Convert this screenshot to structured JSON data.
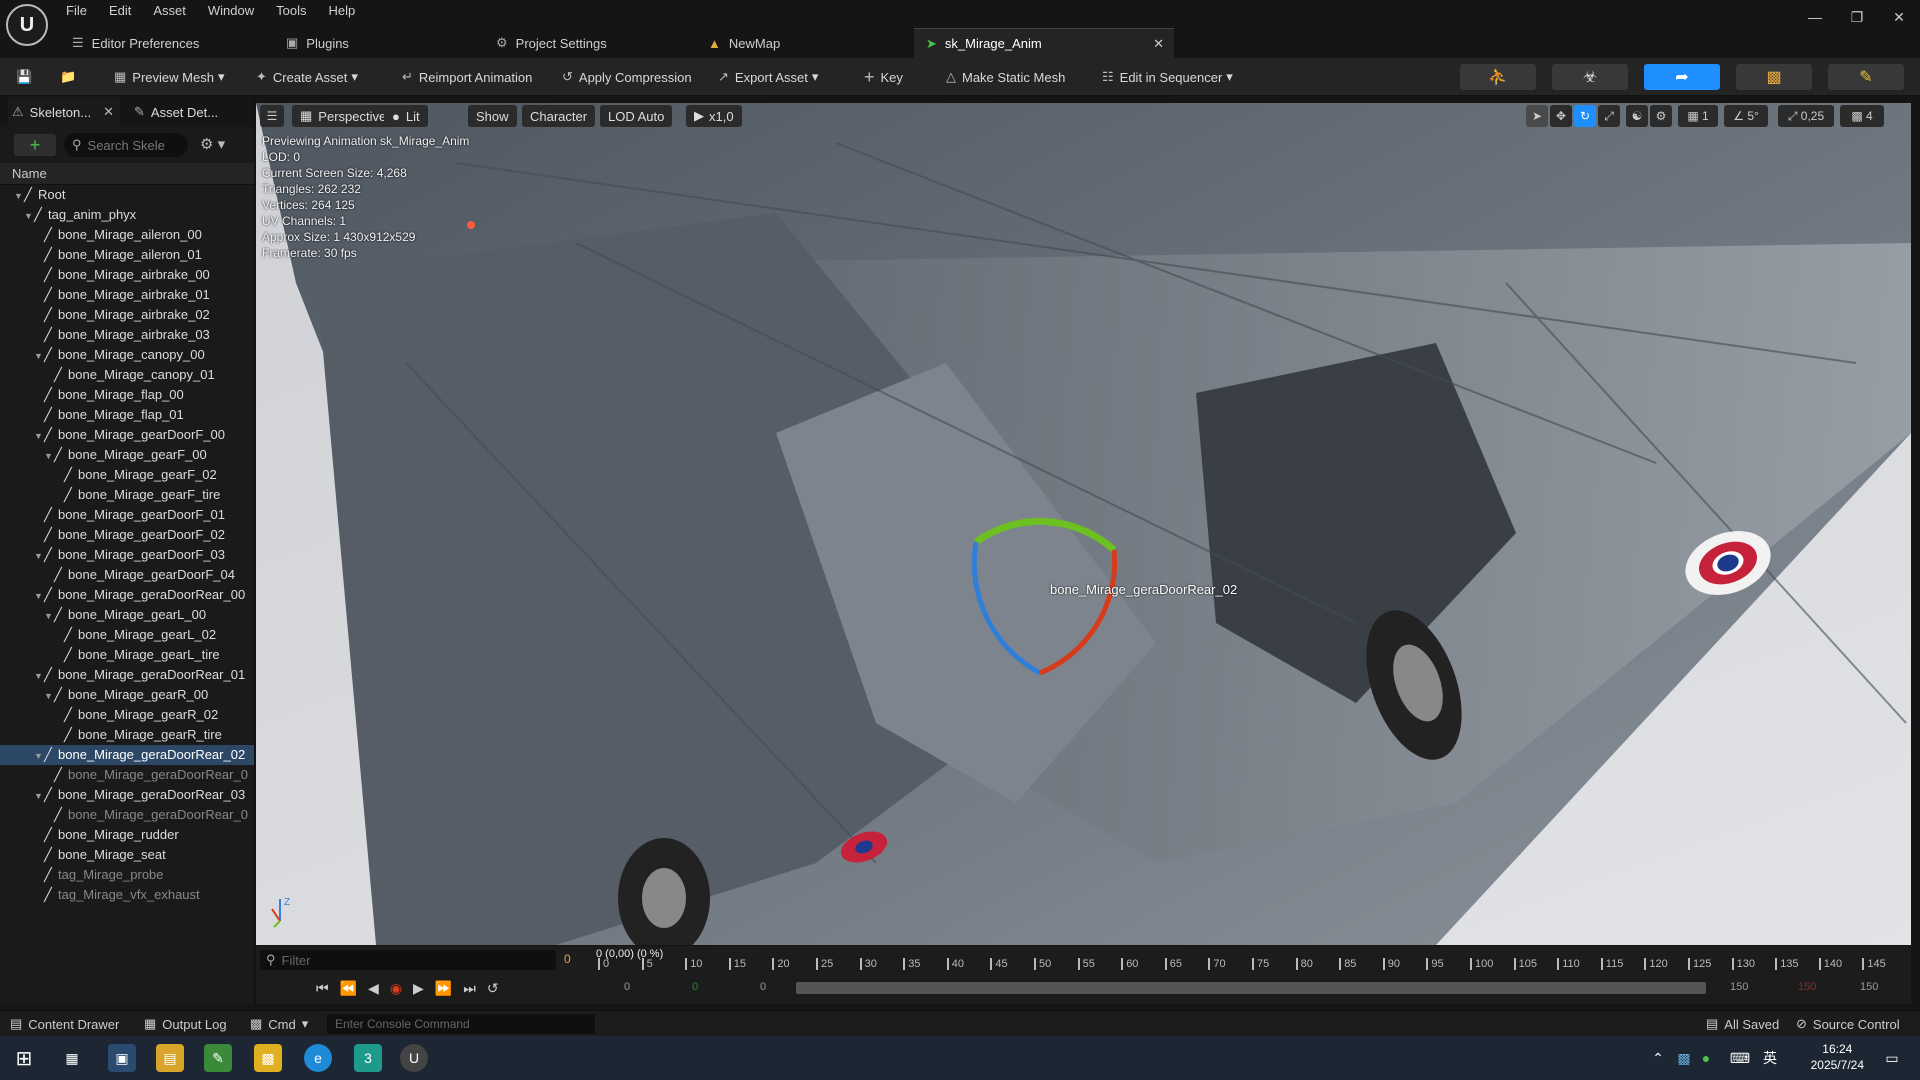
{
  "menubar": {
    "items": [
      "File",
      "Edit",
      "Asset",
      "Window",
      "Tools",
      "Help"
    ]
  },
  "editor_tabs": [
    {
      "label": "Editor Preferences",
      "icon": "sliders-icon"
    },
    {
      "label": "Plugins",
      "icon": "plug-icon"
    },
    {
      "label": "Project Settings",
      "icon": "gear-icon"
    },
    {
      "label": "NewMap",
      "icon": "map-icon"
    },
    {
      "label": "sk_Mirage_Anim",
      "icon": "animation-icon",
      "active": true
    }
  ],
  "toolbar": {
    "preview_mesh": "Preview Mesh",
    "create_asset": "Create Asset",
    "reimport": "Reimport Animation",
    "apply_compression": "Apply Compression",
    "export_asset": "Export Asset",
    "key": "Key",
    "make_static_mesh": "Make Static Mesh",
    "edit_in_sequencer": "Edit in Sequencer",
    "accent_color": "#1f8fff"
  },
  "left_panel": {
    "tabs": [
      "Skeleton...",
      "Asset Det..."
    ],
    "search_placeholder": "Search Skele",
    "column_header": "Name",
    "tree": [
      {
        "label": "Root",
        "depth": 0,
        "expanded": true
      },
      {
        "label": "tag_anim_phyx",
        "depth": 1,
        "expanded": true
      },
      {
        "label": "bone_Mirage_aileron_00",
        "depth": 2
      },
      {
        "label": "bone_Mirage_aileron_01",
        "depth": 2
      },
      {
        "label": "bone_Mirage_airbrake_00",
        "depth": 2
      },
      {
        "label": "bone_Mirage_airbrake_01",
        "depth": 2
      },
      {
        "label": "bone_Mirage_airbrake_02",
        "depth": 2
      },
      {
        "label": "bone_Mirage_airbrake_03",
        "depth": 2
      },
      {
        "label": "bone_Mirage_canopy_00",
        "depth": 2,
        "expanded": true
      },
      {
        "label": "bone_Mirage_canopy_01",
        "depth": 3
      },
      {
        "label": "bone_Mirage_flap_00",
        "depth": 2
      },
      {
        "label": "bone_Mirage_flap_01",
        "depth": 2
      },
      {
        "label": "bone_Mirage_gearDoorF_00",
        "depth": 2,
        "expanded": true
      },
      {
        "label": "bone_Mirage_gearF_00",
        "depth": 3,
        "expanded": true
      },
      {
        "label": "bone_Mirage_gearF_02",
        "depth": 4
      },
      {
        "label": "bone_Mirage_gearF_tire",
        "depth": 4
      },
      {
        "label": "bone_Mirage_gearDoorF_01",
        "depth": 2
      },
      {
        "label": "bone_Mirage_gearDoorF_02",
        "depth": 2
      },
      {
        "label": "bone_Mirage_gearDoorF_03",
        "depth": 2,
        "expanded": true
      },
      {
        "label": "bone_Mirage_gearDoorF_04",
        "depth": 3
      },
      {
        "label": "bone_Mirage_geraDoorRear_00",
        "depth": 2,
        "expanded": true
      },
      {
        "label": "bone_Mirage_gearL_00",
        "depth": 3,
        "expanded": true
      },
      {
        "label": "bone_Mirage_gearL_02",
        "depth": 4
      },
      {
        "label": "bone_Mirage_gearL_tire",
        "depth": 4
      },
      {
        "label": "bone_Mirage_geraDoorRear_01",
        "depth": 2,
        "expanded": true
      },
      {
        "label": "bone_Mirage_gearR_00",
        "depth": 3,
        "expanded": true
      },
      {
        "label": "bone_Mirage_gearR_02",
        "depth": 4
      },
      {
        "label": "bone_Mirage_gearR_tire",
        "depth": 4
      },
      {
        "label": "bone_Mirage_geraDoorRear_02",
        "depth": 2,
        "expanded": true,
        "selected": true
      },
      {
        "label": "bone_Mirage_geraDoorRear_0",
        "depth": 3,
        "dim": true
      },
      {
        "label": "bone_Mirage_geraDoorRear_03",
        "depth": 2,
        "expanded": true
      },
      {
        "label": "bone_Mirage_geraDoorRear_0",
        "depth": 3,
        "dim": true
      },
      {
        "label": "bone_Mirage_rudder",
        "depth": 2
      },
      {
        "label": "bone_Mirage_seat",
        "depth": 2
      },
      {
        "label": "tag_Mirage_probe",
        "depth": 2,
        "dim": true
      },
      {
        "label": "tag_Mirage_vfx_exhaust",
        "depth": 2,
        "dim": true
      }
    ]
  },
  "viewport": {
    "perspective": "Perspective",
    "lit": "Lit",
    "show": "Show",
    "character": "Character",
    "lod": "LOD Auto",
    "speed": "x1,0",
    "grid_value": "1",
    "angle_value": "5°",
    "scale_value": "0,25",
    "camera_value": "4",
    "info": [
      "Previewing Animation sk_Mirage_Anim",
      "LOD: 0",
      "Current Screen Size: 4,268",
      "Triangles: 262 232",
      "Vertices: 264 125",
      "UV Channels: 1",
      "Approx Size: 1 430x912x529",
      "Framerate: 30 fps"
    ],
    "selected_bone_label": "bone_Mirage_geraDoorRear_02"
  },
  "timeline": {
    "filter_placeholder": "Filter",
    "current_value": "0",
    "time_header": "0 (0,00) (0 %)",
    "ticks": [
      "0",
      "5",
      "10",
      "15",
      "20",
      "25",
      "30",
      "35",
      "40",
      "45",
      "50",
      "55",
      "60",
      "65",
      "70",
      "75",
      "80",
      "85",
      "90",
      "95",
      "100",
      "105",
      "110",
      "115",
      "120",
      "125",
      "130",
      "135",
      "140",
      "145"
    ],
    "start_a": "0",
    "start_b": "0",
    "start_c": "0",
    "end_a": "150",
    "end_b": "150",
    "end_c": "150"
  },
  "statusbar": {
    "content_drawer": "Content Drawer",
    "output_log": "Output Log",
    "cmd": "Cmd",
    "console_placeholder": "Enter Console Command",
    "all_saved": "All Saved",
    "source_control": "Source Control"
  },
  "taskbar": {
    "time": "16:24",
    "date": "2025/7/24",
    "ime": "英"
  }
}
